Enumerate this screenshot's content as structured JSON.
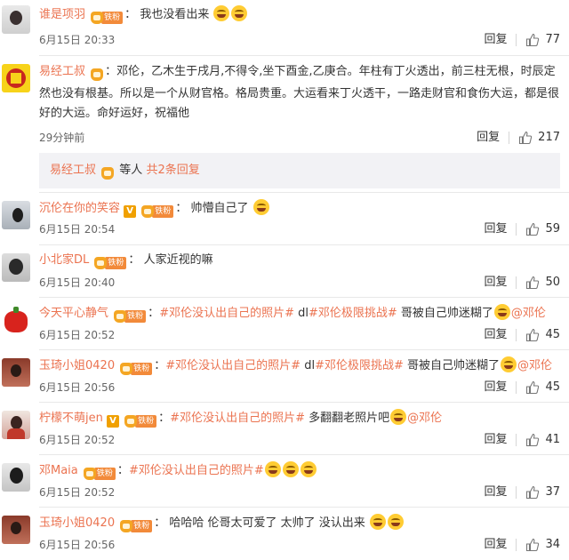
{
  "colors": {
    "accent": "#eb7350",
    "fan_badge": "#f28a3a",
    "text": "#333333",
    "muted": "#666666"
  },
  "reply_label": "回复",
  "comments": [
    {
      "user": "谁是项羽",
      "text": "我也没看出来",
      "emojis": 2,
      "time": "6月15日 20:33",
      "likes": "77"
    },
    {
      "user": "易经工叔",
      "text": "邓伦，乙木生于戌月,不得令,坐下酉金,乙庚合。年柱有丁火透出，前三柱无根，时辰定然也没有根基。所以是一个从财官格。格局贵重。大运看来丁火透干，一路走财官和食伤大运，都是很好的大运。命好运好，祝福他",
      "time": "29分钟前",
      "likes": "217"
    },
    {
      "user": "沉伦在你的笑容",
      "text": "帅懵自己了",
      "time": "6月15日 20:54",
      "likes": "59"
    },
    {
      "user": "小北家DL",
      "text": "人家近视的嘛",
      "time": "6月15日 20:40",
      "likes": "50"
    },
    {
      "user": "今天平心静气",
      "tag1": "#邓伦没认出自己的照片#",
      "mid": " dl",
      "tag2": "#邓伦极限挑战#",
      "text": " 哥被自己帅迷糊了",
      "mention": "@邓伦",
      "time": "6月15日 20:52",
      "likes": "45"
    },
    {
      "user": "玉琦小姐0420",
      "tag1": "#邓伦没认出自己的照片#",
      "mid": " dl",
      "tag2": "#邓伦极限挑战#",
      "text": " 哥被自己帅迷糊了",
      "mention": "@邓伦",
      "time": "6月15日 20:56",
      "likes": "45"
    },
    {
      "user": "柠檬不萌jen",
      "tag1": "#邓伦没认出自己的照片#",
      "text": " 多翻翻老照片吧",
      "mention": "@邓伦",
      "time": "6月15日 20:52",
      "likes": "41"
    },
    {
      "user": "邓Maia",
      "tag1": "#邓伦没认出自己的照片#",
      "time": "6月15日 20:52",
      "likes": "37"
    },
    {
      "user": "玉琦小姐0420",
      "text": "哈哈哈 伦哥太可爱了 太帅了 没认出来",
      "time": "6月15日 20:56",
      "likes": "34"
    }
  ],
  "sub_replies": {
    "user": "易经工叔",
    "text": "等人",
    "count_text": "共2条回复"
  },
  "fan_badge_label": "铁粉",
  "vip_badge_label": "V"
}
